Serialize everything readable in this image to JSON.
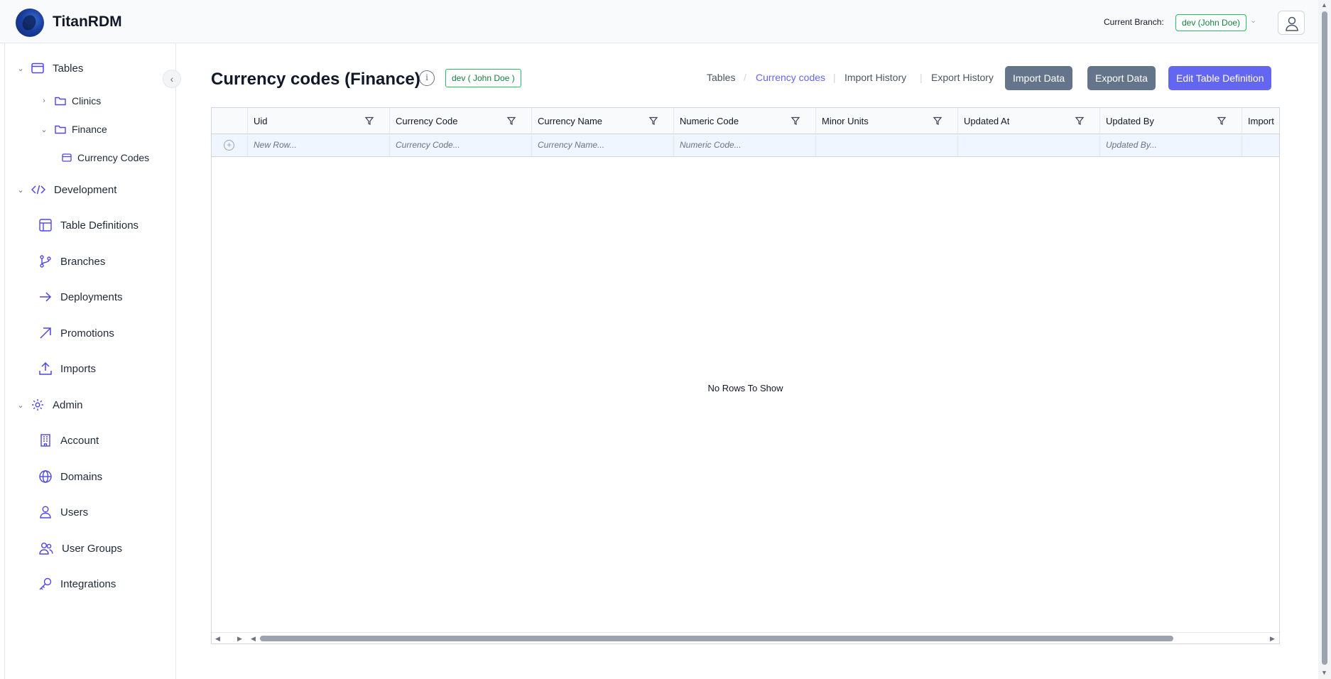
{
  "app": {
    "title": "TitanRDM"
  },
  "header": {
    "branch_label": "Current Branch:",
    "branch_value": "dev (John Doe)"
  },
  "sidebar": {
    "tables": {
      "label": "Tables",
      "children": [
        {
          "label": "Clinics"
        },
        {
          "label": "Finance",
          "children": [
            {
              "label": "Currency Codes"
            }
          ]
        }
      ]
    },
    "development": {
      "label": "Development",
      "items": [
        {
          "label": "Table Definitions"
        },
        {
          "label": "Branches"
        },
        {
          "label": "Deployments"
        },
        {
          "label": "Promotions"
        },
        {
          "label": "Imports"
        }
      ]
    },
    "admin": {
      "label": "Admin",
      "items": [
        {
          "label": "Account"
        },
        {
          "label": "Domains"
        },
        {
          "label": "Users"
        },
        {
          "label": "User Groups"
        },
        {
          "label": "Integrations"
        }
      ]
    }
  },
  "main": {
    "title": "Currency codes (Finance)",
    "branch_badge": "dev ( John Doe )",
    "breadcrumb": [
      "Tables",
      "Currency codes",
      "Import History",
      "Export History"
    ],
    "buttons": {
      "import": "Import Data",
      "export": "Export Data",
      "edit": "Edit Table Definition"
    }
  },
  "grid": {
    "columns": [
      "Uid",
      "Currency Code",
      "Currency Name",
      "Numeric Code",
      "Minor Units",
      "Updated At",
      "Updated By",
      "Import"
    ],
    "new_row_placeholders": [
      "New Row...",
      "Currency Code...",
      "Currency Name...",
      "Numeric Code...",
      "",
      "",
      "Updated By...",
      ""
    ],
    "empty_message": "No Rows To Show"
  },
  "colors": {
    "accent": "#6366f1",
    "branch": "#22c55e",
    "button_gray": "#64748b"
  }
}
